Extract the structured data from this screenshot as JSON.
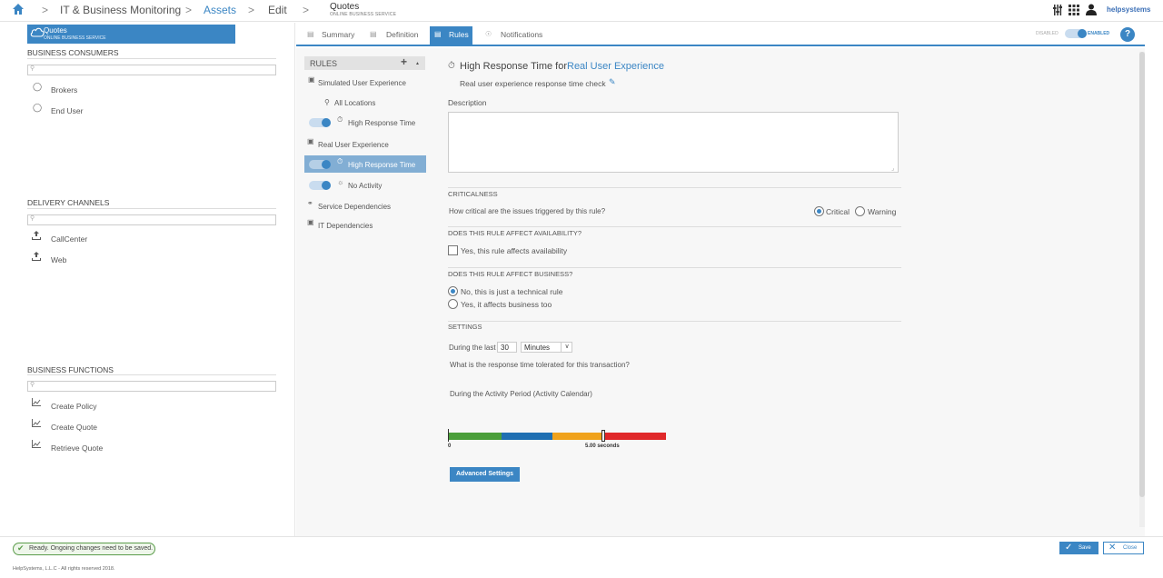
{
  "breadcrumb": {
    "items": [
      "IT & Business Monitoring",
      "Assets",
      "Edit"
    ],
    "current_title": "Quotes",
    "current_subtitle": "ONLINE BUSINESS SERVICE",
    "separator": ">"
  },
  "header_icons": [
    "sliders-icon",
    "apps-grid-icon",
    "user-icon"
  ],
  "brand": "helpsystems",
  "asset": {
    "title": "Quotes",
    "subtitle": "ONLINE BUSINESS SERVICE"
  },
  "left": {
    "sections": [
      {
        "title": "BUSINESS CONSUMERS",
        "items": [
          "Brokers",
          "End User"
        ]
      },
      {
        "title": "DELIVERY CHANNELS",
        "items": [
          "CallCenter",
          "Web"
        ]
      },
      {
        "title": "BUSINESS FUNCTIONS",
        "items": [
          "Create Policy",
          "Create Quote",
          "Retrieve Quote"
        ]
      }
    ]
  },
  "tabs": [
    {
      "label": "Summary"
    },
    {
      "label": "Definition"
    },
    {
      "label": "Rules",
      "active": true
    },
    {
      "label": "Notifications"
    }
  ],
  "enable_toggle": {
    "off_label": "DISABLED",
    "on_label": "ENABLED",
    "state": "enabled"
  },
  "help_label": "?",
  "rules": {
    "header": "RULES",
    "add_label": "+",
    "tree": [
      {
        "label": "Simulated User Experience",
        "level": 0
      },
      {
        "label": "All Locations",
        "level": 1
      },
      {
        "label": "High Response Time",
        "level": 2,
        "toggle": true
      },
      {
        "label": "Real User Experience",
        "level": 0
      },
      {
        "label": "High Response Time",
        "level": 2,
        "toggle": true,
        "selected": true
      },
      {
        "label": "No Activity",
        "level": 2,
        "toggle": true
      },
      {
        "label": "Service Dependencies",
        "level": 0
      },
      {
        "label": "IT Dependencies",
        "level": 0
      }
    ]
  },
  "form": {
    "title_prefix": "High Response Time for",
    "title_link": "Real User Experience",
    "subtitle": "Real user experience response time check",
    "description_label": "Description",
    "description_value": "",
    "criticalness": {
      "section": "CRITICALNESS",
      "question": "How critical are the issues triggered by this rule?",
      "options": [
        "Critical",
        "Warning"
      ],
      "selected": "Critical"
    },
    "availability": {
      "section": "DOES THIS RULE AFFECT AVAILABILITY?",
      "checkbox_label": "Yes, this rule affects availability",
      "checked": false
    },
    "business": {
      "section": "DOES THIS RULE AFFECT BUSINESS?",
      "options": [
        "No, this is just a technical rule",
        "Yes, it affects business too"
      ],
      "selected": "No, this is just a technical rule"
    },
    "settings": {
      "section": "SETTINGS",
      "during_label": "During the last",
      "duration_value": "30",
      "unit_value": "Minutes",
      "question": "What is the response time tolerated for this transaction?",
      "period_label": "During the Activity Period (Activity Calendar)",
      "scale_min": "0",
      "scale_threshold": "5.00 seconds",
      "threshold_fraction": 0.71,
      "segment_colors": [
        "#4a9e3a",
        "#1f6fb2",
        "#f0a21c",
        "#e0282a"
      ]
    },
    "advanced_button": "Advanced Settings"
  },
  "footer": {
    "status": "Ready. Ongoing changes need to be saved.",
    "copyright": "HelpSystems, L.L.C - All rights reserved 2018.",
    "save_label": "Save",
    "close_label": "Close"
  }
}
